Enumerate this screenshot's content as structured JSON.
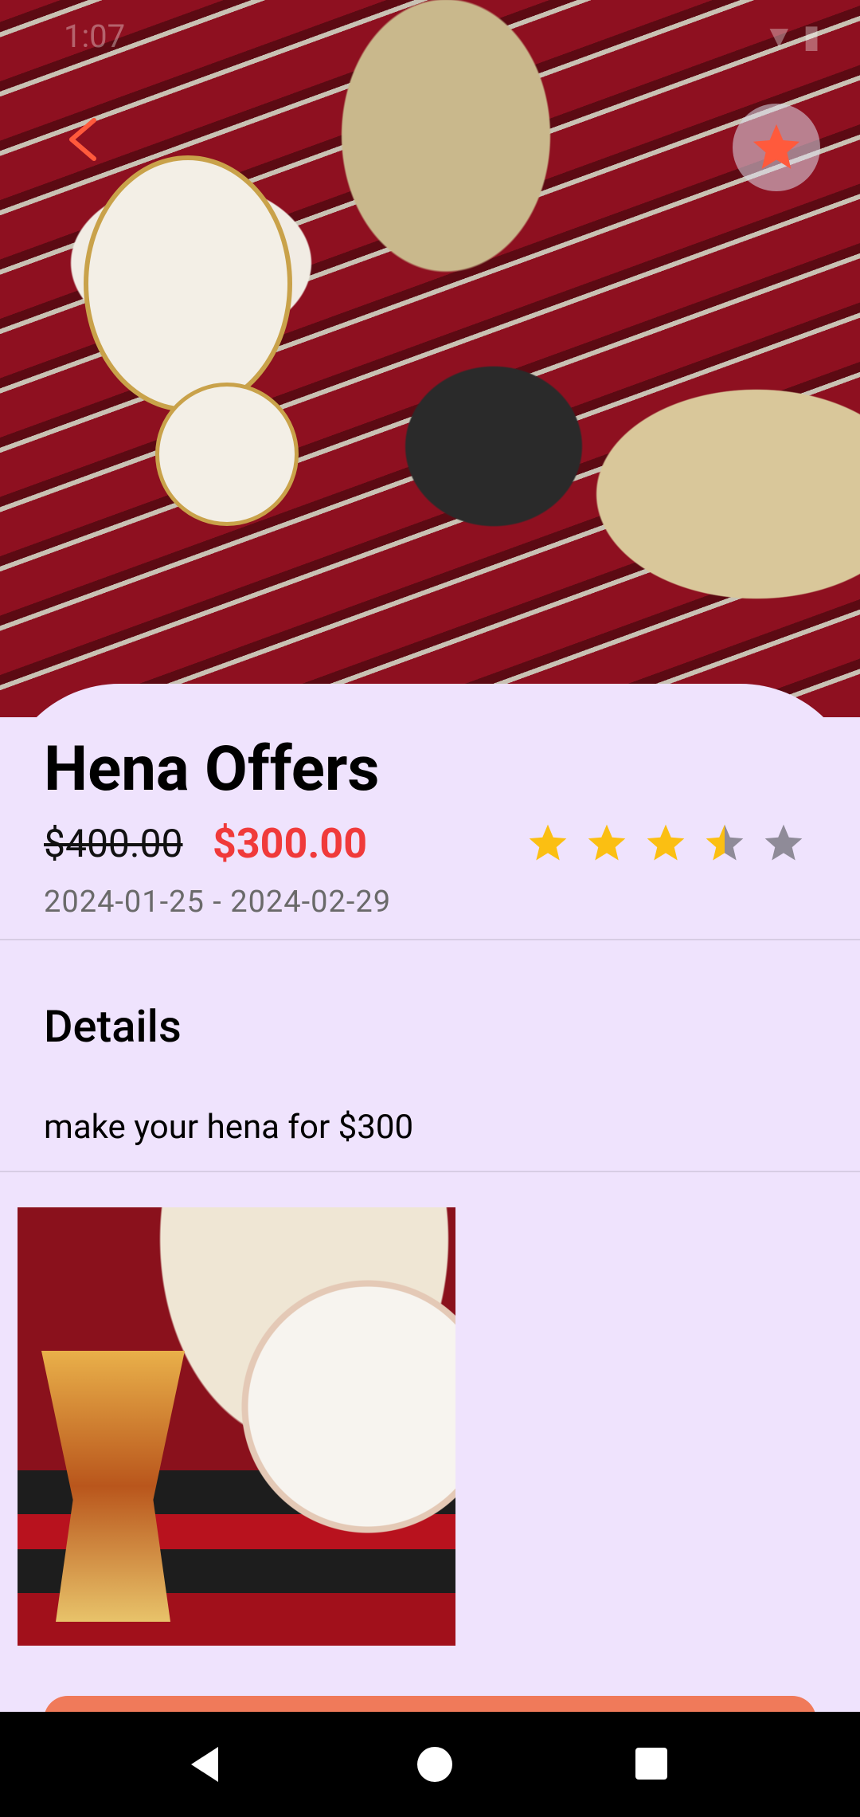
{
  "status_bar": {
    "time": "1:07",
    "icons": "▼ ▮"
  },
  "offer": {
    "title": "Hena Offers",
    "old_price": "$400.00",
    "new_price": "$300.00",
    "rating": 3.5,
    "rating_max": 5,
    "date_range": "2024-01-25 - 2024-02-29"
  },
  "details": {
    "heading": "Details",
    "description": "make your hena for $300"
  },
  "colors": {
    "accent": "#ff5a3c",
    "price_red": "#f03a3a",
    "star_filled": "#fbbf12",
    "star_empty": "#8f8b98",
    "background": "#efe3fd"
  },
  "icons": {
    "back": "back-arrow-icon",
    "favorite": "star-icon",
    "rating": "star-icon"
  }
}
